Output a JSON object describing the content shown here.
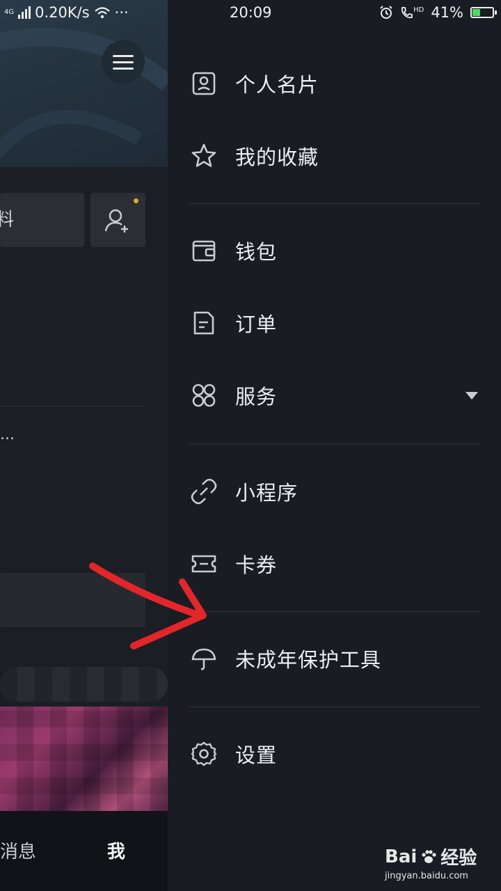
{
  "status_bar": {
    "signal": "4G",
    "speed": "0.20K/s",
    "more": "···",
    "time": "20:09",
    "hd": "HD",
    "battery": "41%",
    "battery_level": 0.41,
    "battery_color": "#4cd964"
  },
  "background_page": {
    "edit_fragment": "料",
    "ellipsis": "...",
    "nav_messages": "消息",
    "nav_me": "我",
    "dot_color": "#d4b02a"
  },
  "drawer": {
    "items": [
      {
        "label": "个人名片",
        "icon": "profile-card-icon"
      },
      {
        "label": "我的收藏",
        "icon": "star-icon"
      },
      {
        "label": "钱包",
        "icon": "wallet-icon"
      },
      {
        "label": "订单",
        "icon": "order-document-icon"
      },
      {
        "label": "服务",
        "icon": "services-grid-icon"
      },
      {
        "label": "小程序",
        "icon": "mini-program-link-icon"
      },
      {
        "label": "卡券",
        "icon": "coupon-ticket-icon"
      },
      {
        "label": "未成年保护工具",
        "icon": "umbrella-icon"
      },
      {
        "label": "设置",
        "icon": "gear-icon"
      }
    ]
  },
  "annotation": {
    "arrow_color": "#e3262a"
  },
  "watermark": {
    "brand": "Bai",
    "brand_suffix": "经验",
    "url": "jingyan.baidu.com"
  }
}
